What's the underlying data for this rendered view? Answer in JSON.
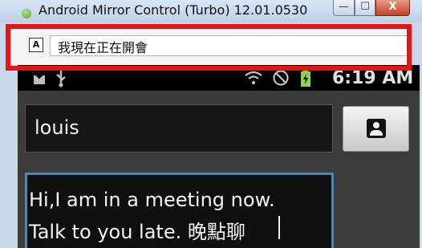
{
  "window": {
    "title": "Android Mirror Control (Turbo) 12.01.0530",
    "controls": {
      "minimize": "—",
      "maximize": "☐",
      "close": "X"
    }
  },
  "input_panel": {
    "ime_indicator": "A",
    "text_value": "我現在正在開會"
  },
  "status_bar": {
    "time": "6:19 AM",
    "icons": [
      "download-icon",
      "usb-icon",
      "wifi-icon",
      "blocked-icon",
      "battery-icon"
    ]
  },
  "compose": {
    "recipient": "louis",
    "message_lines": [
      " Hi,I am in a meeting now.",
      "Talk to you late. 晚點聊"
    ]
  },
  "colors": {
    "highlight_frame": "#e31515",
    "message_focus_border": "#2f8fd6"
  }
}
